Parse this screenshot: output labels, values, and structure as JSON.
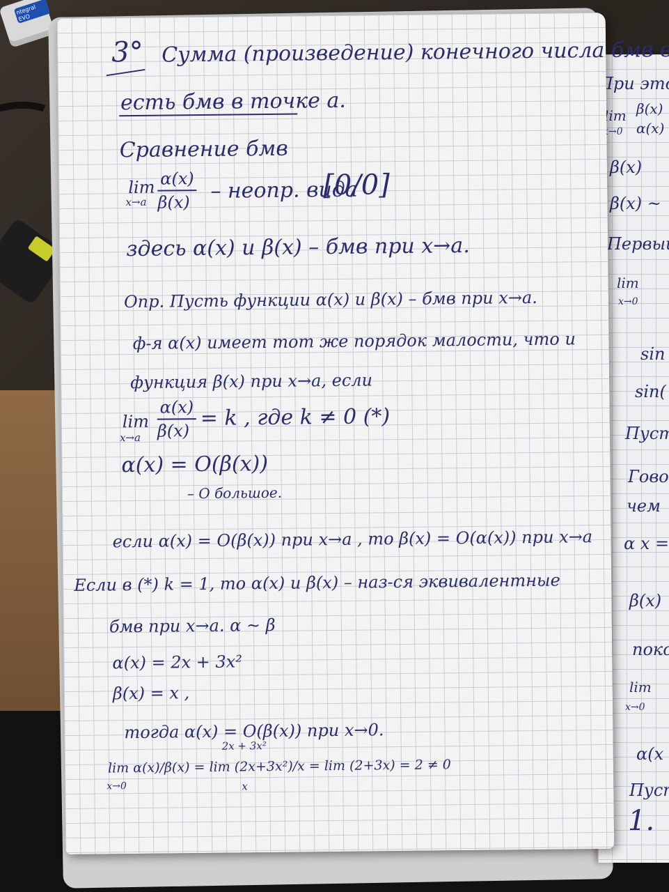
{
  "photo": {
    "usb_stick_label": "ntegral\nEVO"
  },
  "notebook": {
    "lines": [
      "3°",
      "Сумма (произведение) конечного числа бмв в точке a",
      "есть бмв в точке a.",
      "Сравнение бмв",
      "lim",
      "x→a",
      "α(x)",
      "β(x)",
      "– неопр. вида",
      "[0/0]",
      "здесь  α(x) и β(x) – бмв  при  x→a.",
      "Опр. Пусть функции α(x) и β(x) – бмв при x→a.",
      "ф-я  α(x) имеет тот же порядок малости, что и",
      "функция β(x) при x→a, если",
      "= k , где k ≠ 0   (*)",
      "α(x) = O(β(x))",
      "– O большое.",
      "если α(x) = O(β(x)) при x→a , то β(x) = O(α(x)) при x→a",
      "Если в (*) k = 1, то α(x) и β(x) – наз-ся эквивалентные",
      "бмв  при x→a.   α ~ β",
      "α(x) = 2x + 3x²",
      "β(x) = x ,",
      "тогда  α(x) = O(β(x))  при  x→0.",
      "lim α(x)/β(x) = lim (2x+3x²)/x = lim (2+3x) = 2 ≠ 0",
      "x→0",
      "2x + 3x²",
      "x"
    ]
  },
  "right_page": {
    "lines": [
      "При этом",
      "lim",
      "x→0",
      "β(x)",
      "α(x)",
      "β(x)",
      "β(x) ~",
      "Первый",
      "lim",
      "x→0",
      "sin",
      "sin(",
      "Пусть",
      "Говор",
      "чем",
      "α x =",
      "β(x)",
      "покс",
      "lim",
      "x→0",
      "α(x",
      "Пусть",
      "1."
    ]
  }
}
